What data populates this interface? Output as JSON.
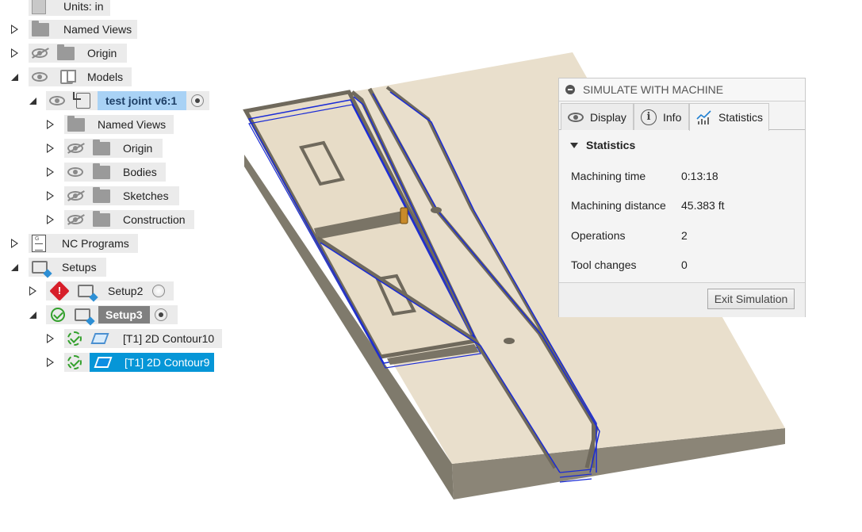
{
  "browser": {
    "units": "Units: in",
    "named_views": "Named Views",
    "origin": "Origin",
    "models": "Models",
    "component": "test joint v6:1",
    "sub_named_views": "Named Views",
    "sub_origin": "Origin",
    "bodies": "Bodies",
    "sketches": "Sketches",
    "construction": "Construction",
    "nc_programs": "NC Programs",
    "setups": "Setups",
    "setup2": "Setup2",
    "setup2_warning_glyph": "!",
    "setup3": "Setup3",
    "op1": "[T1] 2D Contour10",
    "op2": "[T1] 2D Contour9"
  },
  "panel": {
    "title": "SIMULATE WITH MACHINE",
    "tabs": {
      "display": "Display",
      "info": "Info",
      "statistics": "Statistics"
    },
    "section": "Statistics",
    "stats": [
      {
        "label": "Machining time",
        "value": "0:13:18"
      },
      {
        "label": "Machining distance",
        "value": "45.383 ft"
      },
      {
        "label": "Operations",
        "value": "2"
      },
      {
        "label": "Tool changes",
        "value": "0"
      }
    ],
    "exit_button": "Exit Simulation"
  },
  "colors": {
    "stock_top": "#e8decb",
    "stock_side": "#8a8578",
    "groove": "#7a7466",
    "toolpath": "#1a2bd6",
    "selection_blue": "#0696d7",
    "selection_light": "#a9d2f5"
  }
}
